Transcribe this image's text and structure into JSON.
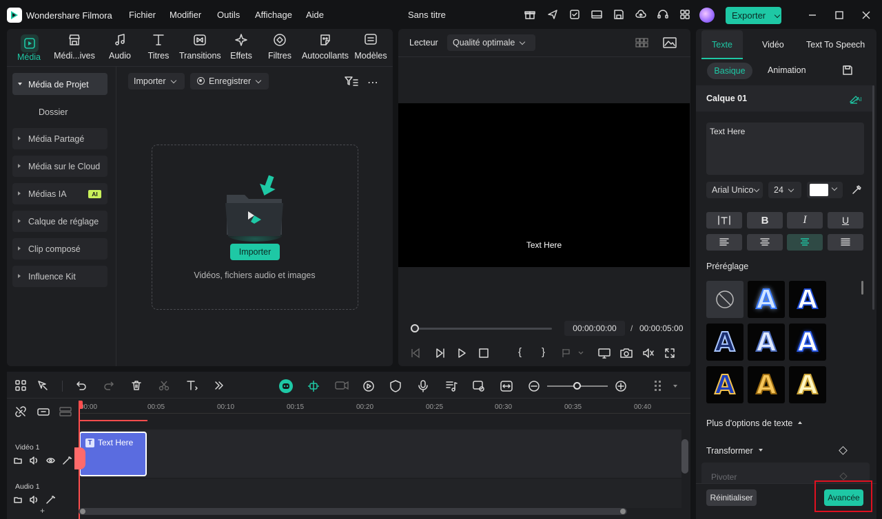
{
  "app": {
    "title": "Wondershare Filmora",
    "project": "Sans titre"
  },
  "menu": [
    "Fichier",
    "Modifier",
    "Outils",
    "Affichage",
    "Aide"
  ],
  "export_label": "Exporter",
  "media_tabs": [
    "Média",
    "Médi...ives",
    "Audio",
    "Titres",
    "Transitions",
    "Effets",
    "Filtres",
    "Autocollants",
    "Modèles"
  ],
  "sidebar": {
    "project_media": "Média de Projet",
    "folder": "Dossier",
    "items": [
      "Média Partagé",
      "Média sur le Cloud",
      "Médias IA",
      "Calque de réglage",
      "Clip composé",
      "Influence Kit"
    ],
    "ai_badge": "AI"
  },
  "media_toolbar": {
    "import": "Importer",
    "record": "Enregistrer"
  },
  "dropzone": {
    "button": "Importer",
    "hint": "Vidéos, fichiers audio et images"
  },
  "player": {
    "label": "Lecteur",
    "quality": "Qualité optimale",
    "overlay_text": "Text Here",
    "current_time": "00:00:00:00",
    "separator": "/",
    "total_time": "00:00:05:00"
  },
  "right_panel": {
    "tabs": [
      "Texte",
      "Vidéo",
      "Text To Speech"
    ],
    "subtabs": [
      "Basique",
      "Animation"
    ],
    "layer": "Calque 01",
    "ai_tag": "AI",
    "text_value": "Text Here",
    "font": "Arial Unico",
    "size": "24",
    "color": "#ffffff",
    "format_buttons": [
      "B",
      "I",
      "U"
    ],
    "presets_label": "Préréglage",
    "more_options": "Plus d'options de texte",
    "transform": "Transformer",
    "rotate": "Pivoter",
    "reset": "Réinitialiser",
    "advanced": "Avancée"
  },
  "timeline": {
    "ruler": [
      "00:00",
      "00:05",
      "00:10",
      "00:15",
      "00:20",
      "00:25",
      "00:30",
      "00:35",
      "00:40"
    ],
    "video_track": "Vidéo 1",
    "audio_track": "Audio 1",
    "clip_label": "Text Here"
  },
  "colors": {
    "accent": "#1ec8a5",
    "clip": "#5a6ce0",
    "playhead": "#ff4d4d",
    "highlight_box": "#e01020"
  }
}
